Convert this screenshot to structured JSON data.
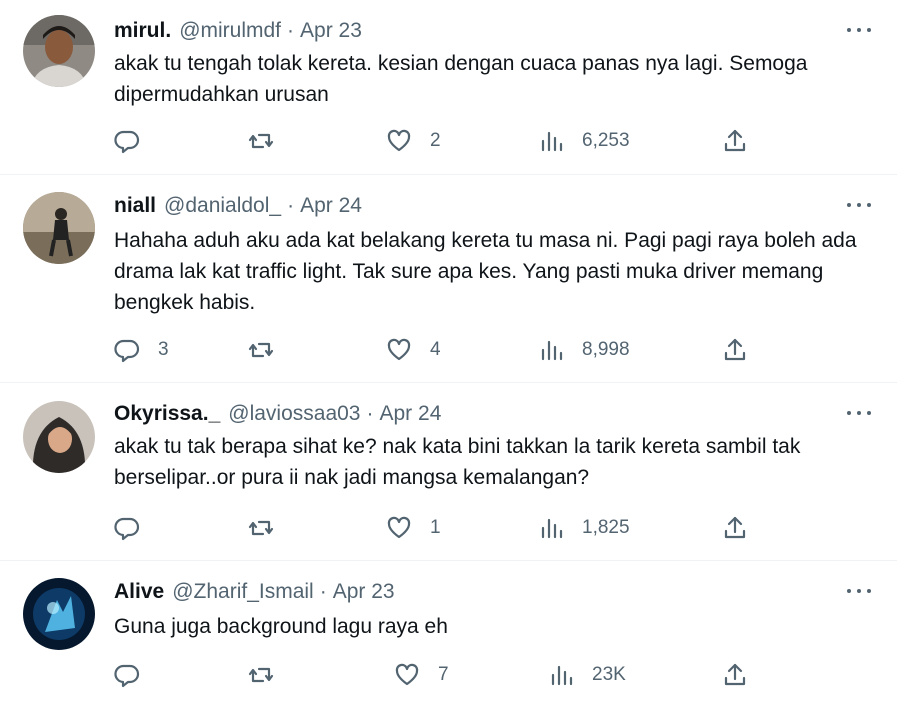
{
  "replies": [
    {
      "name": "mirul.",
      "handle": "@mirulmdf",
      "date": "Apr 23",
      "text": "akak tu tengah tolak kereta. kesian dengan cuaca panas nya lagi. Semoga dipermudahkan urusan",
      "reply_count": "",
      "retweet_count": "",
      "like_count": "2",
      "view_count": "6,253"
    },
    {
      "name": "niall",
      "handle": "@danialdol_",
      "date": "Apr 24",
      "text": "Hahaha aduh aku ada kat belakang kereta tu masa ni. Pagi pagi raya boleh ada drama lak kat traffic light. Tak sure apa kes. Yang pasti muka driver memang bengkek habis.",
      "reply_count": "3",
      "retweet_count": "",
      "like_count": "4",
      "view_count": "8,998"
    },
    {
      "name": "Okyrissa._",
      "handle": "@laviossaa03",
      "date": "Apr 24",
      "text": "akak tu tak berapa sihat ke? nak kata bini takkan la tarik kereta sambil tak berselipar..or pura ii nak jadi mangsa kemalangan?",
      "reply_count": "",
      "retweet_count": "",
      "like_count": "1",
      "view_count": "1,825"
    },
    {
      "name": "Alive",
      "handle": "@Zharif_Ismail",
      "date": "Apr 23",
      "text": "Guna juga background lagu raya eh",
      "reply_count": "",
      "retweet_count": "",
      "like_count": "7",
      "view_count": "23K"
    }
  ],
  "separator": "·",
  "icons": {
    "reply": "reply-icon",
    "retweet": "retweet-icon",
    "like": "heart-icon",
    "views": "views-icon",
    "share": "share-icon",
    "more": "more-icon"
  },
  "colors": {
    "text": "#0f1419",
    "secondary": "#536471",
    "divider": "#eff3f4"
  }
}
